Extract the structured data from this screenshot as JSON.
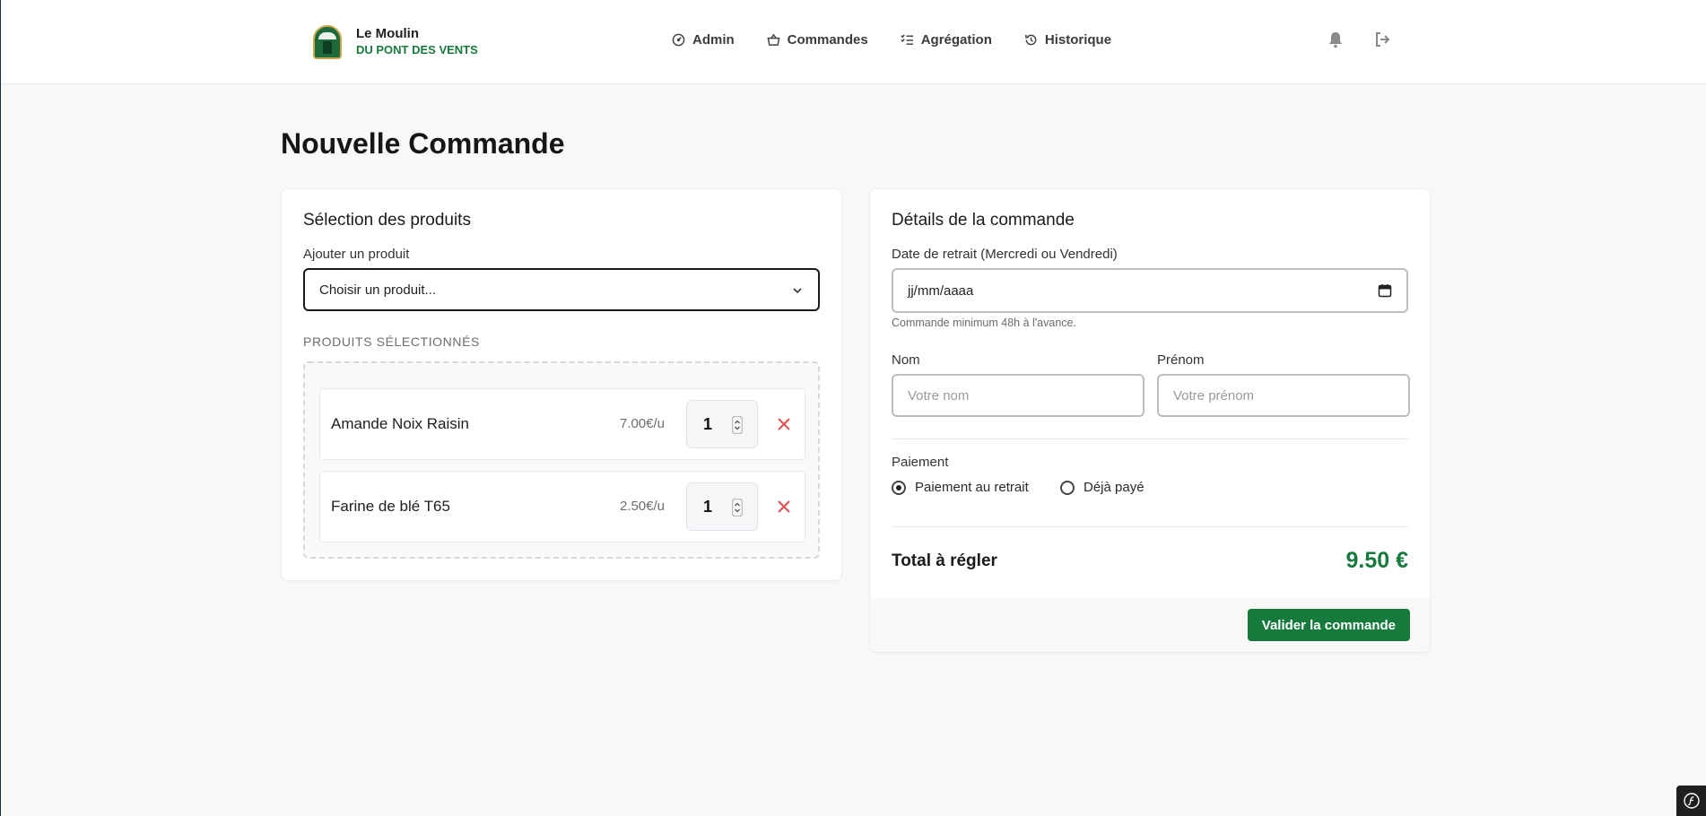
{
  "brand": {
    "name": "Le Moulin",
    "subtitle": "DU PONT DES VENTS"
  },
  "nav": {
    "items": [
      {
        "label": "Admin",
        "icon": "gauge-icon"
      },
      {
        "label": "Commandes",
        "icon": "basket-icon"
      },
      {
        "label": "Agrégation",
        "icon": "list-check-icon"
      },
      {
        "label": "Historique",
        "icon": "history-icon"
      }
    ]
  },
  "header_icons": [
    "bell-icon",
    "logout-icon"
  ],
  "page": {
    "title": "Nouvelle Commande"
  },
  "products": {
    "title": "Sélection des produits",
    "add_label": "Ajouter un produit",
    "select_placeholder": "Choisir un produit...",
    "selected_heading": "PRODUITS SÉLECTIONNÉS",
    "items": [
      {
        "name": "Amande Noix Raisin",
        "price": "7.00€/u",
        "qty": "1"
      },
      {
        "name": "Farine de blé T65",
        "price": "2.50€/u",
        "qty": "1"
      }
    ]
  },
  "details": {
    "title": "Détails de la commande",
    "date_label": "Date de retrait (Mercredi ou Vendredi)",
    "date_placeholder": "jj/mm/aaaa",
    "date_hint": "Commande minimum 48h à l'avance.",
    "nom_label": "Nom",
    "nom_placeholder": "Votre nom",
    "prenom_label": "Prénom",
    "prenom_placeholder": "Votre prénom",
    "payment_label": "Paiement",
    "payment_options": [
      {
        "label": "Paiement au retrait",
        "checked": true
      },
      {
        "label": "Déjà payé",
        "checked": false
      }
    ],
    "total_label": "Total à régler",
    "total_value": "9.50 €",
    "submit_label": "Valider la commande"
  },
  "colors": {
    "accent": "#177a3d",
    "danger": "#e05252",
    "background": "#f8f8f7"
  }
}
